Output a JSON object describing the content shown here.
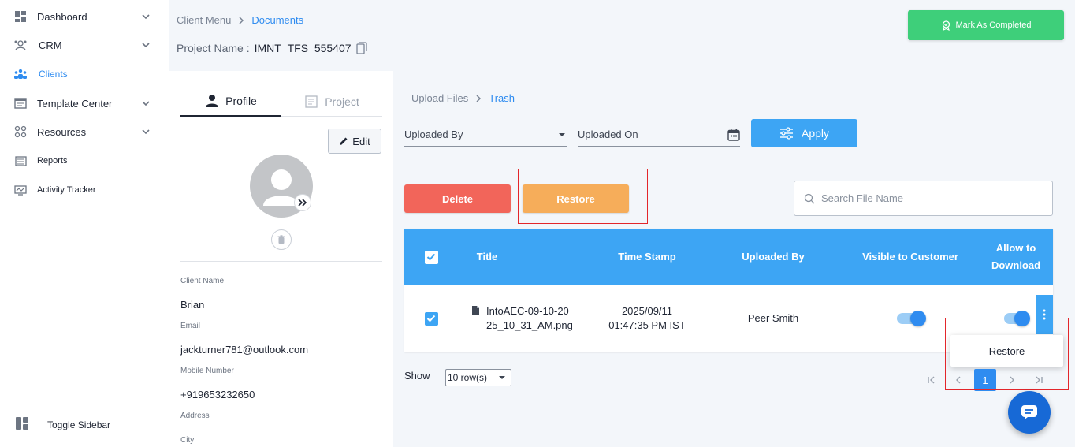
{
  "sidebar": {
    "items": [
      {
        "label": "Dashboard",
        "icon": "dashboard-icon",
        "has_chevron": true
      },
      {
        "label": "CRM",
        "icon": "crm-icon",
        "has_chevron": true
      },
      {
        "label": "Clients",
        "icon": "clients-icon",
        "active": true
      },
      {
        "label": "Template Center",
        "icon": "template-icon",
        "has_chevron": true
      },
      {
        "label": "Resources",
        "icon": "resources-icon",
        "has_chevron": true
      },
      {
        "label": "Reports",
        "icon": "reports-icon"
      },
      {
        "label": "Activity Tracker",
        "icon": "activity-icon"
      }
    ],
    "toggle_label": "Toggle Sidebar"
  },
  "header": {
    "breadcrumb": [
      "Client Menu",
      "Documents"
    ],
    "project_name_label": "Project Name :",
    "project_name_value": "IMNT_TFS_555407",
    "mark_completed_label": "Mark As Completed"
  },
  "profile": {
    "tabs": [
      "Profile",
      "Project"
    ],
    "edit_label": "Edit",
    "fields": [
      {
        "label": "Client Name",
        "value": "Brian"
      },
      {
        "label": "Email",
        "value": "jackturner781@outlook.com"
      },
      {
        "label": "Mobile Number",
        "value": "+919653232650"
      },
      {
        "label": "Address",
        "value": ""
      },
      {
        "label": "City",
        "value": ""
      }
    ]
  },
  "main": {
    "breadcrumb": [
      "Upload Files",
      "Trash"
    ],
    "filters": {
      "uploaded_by_label": "Uploaded By",
      "uploaded_on_label": "Uploaded On",
      "apply_label": "Apply"
    },
    "actions": {
      "delete_label": "Delete",
      "restore_label": "Restore"
    },
    "search": {
      "placeholder": "Search File Name",
      "value": ""
    },
    "table": {
      "headers": [
        "Title",
        "Time Stamp",
        "Uploaded By",
        "Visible to Customer",
        "Allow to Download"
      ],
      "rows": [
        {
          "selected": true,
          "title": "IntoAEC-09-10-2025_10_31_AM.png",
          "timestamp_date": "2025/09/11",
          "timestamp_time": "01:47:35 PM IST",
          "uploaded_by": "Peer Smith",
          "visible_to_customer": true,
          "allow_download": true
        }
      ]
    },
    "context_menu": {
      "restore_label": "Restore"
    },
    "pagination": {
      "show_label": "Show",
      "rows_per_page": "10 row(s)",
      "current_page": "1"
    }
  },
  "colors": {
    "accent": "#3da5f4",
    "success": "#3ecf7a",
    "danger": "#f2655a",
    "warning": "#f6ad5a",
    "highlight_box": "#e3262b"
  }
}
